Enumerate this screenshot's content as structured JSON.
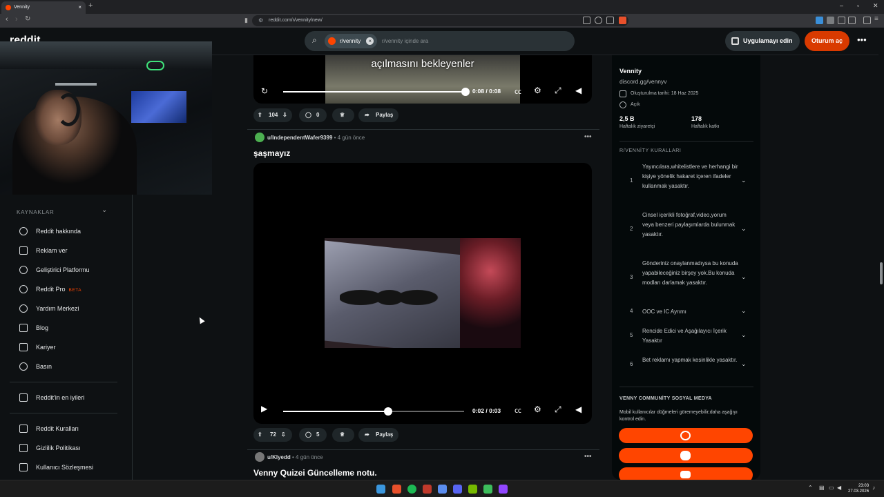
{
  "browser": {
    "tab_title": "Vennity",
    "url": "reddit.com/r/vennity/new/",
    "new_tab": "+",
    "close_tab": "×"
  },
  "header": {
    "logo": "reddit",
    "search_chip": "r/vennity",
    "search_placeholder": "r/vennity içinde ara",
    "get_app_label": "Uygulamayı edin",
    "login_label": "Oturum aç"
  },
  "left_nav": {
    "section_title": "KAYNAKLAR",
    "items": [
      {
        "label": "Reddit hakkında"
      },
      {
        "label": "Reklam ver"
      },
      {
        "label": "Geliştirici Platformu"
      },
      {
        "label": "Reddit Pro",
        "badge": "BETA"
      },
      {
        "label": "Yardım Merkezi"
      },
      {
        "label": "Blog"
      },
      {
        "label": "Kariyer"
      },
      {
        "label": "Basın"
      }
    ],
    "best_of": "Reddit'in en iyileri",
    "legal": [
      {
        "label": "Reddit Kuralları"
      },
      {
        "label": "Gizlilik Politikası"
      },
      {
        "label": "Kullanıcı Sözleşmesi"
      }
    ]
  },
  "feed": {
    "post1": {
      "video_caption": "açılmasını bekleyenler",
      "time": "0:08 / 0:08",
      "progress": 1.0,
      "votes": "104",
      "comments": "0",
      "share": "Paylaş"
    },
    "post2": {
      "author": "u/IndependentWafer9399",
      "age": "• 4 gün önce",
      "title": "şaşmayız",
      "time": "0:02 / 0:03",
      "progress": 0.58,
      "votes": "72",
      "comments": "5",
      "share": "Paylaş"
    },
    "post3": {
      "author": "u/Klyedd",
      "age": "• 4 gün önce",
      "title": "Venny Quizei Güncelleme notu."
    },
    "more": "•••"
  },
  "sidebar": {
    "name": "Vennity",
    "link": "discord.gg/vennyv",
    "created": "Oluşturulma tarihi: 18 Haz 2025",
    "visibility": "Açık",
    "stats": [
      {
        "value": "2,5 B",
        "label": "Haftalık ziyaretçi"
      },
      {
        "value": "178",
        "label": "Haftalık katkı"
      }
    ],
    "rules_title": "R/VENNİTY KURALLARI",
    "rules": [
      {
        "n": "1",
        "text": "Yayıncılara,whitelistlere ve herhangi bir kişiye yönelik hakaret içeren ifadeler kullanmak yasaktır."
      },
      {
        "n": "2",
        "text": "Cinsel içerikli fotoğraf,video,yorum veya benzeri paylaşımlarda bulunmak yasaktır."
      },
      {
        "n": "3",
        "text": "Gönderiniz onaylanmadıysa bu konuda yapabileceğiniz birşey yok.Bu konuda modları darlamak yasaktır."
      },
      {
        "n": "4",
        "text": "OOC ve IC Ayrımı"
      },
      {
        "n": "5",
        "text": "Rencide Edici ve Aşağılayıcı İçerik Yasaktır"
      },
      {
        "n": "6",
        "text": "Bet reklamı yapmak kesinlikle yasaktır."
      }
    ],
    "social_title": "VENNY COMMUNİTY SOSYAL MEDYA",
    "social_desc": "Mobil kullanıcılar düğmeleri göremeyebilir;daha aşağıyı kontrol edin.",
    "social_buttons": [
      {
        "icon": "globe-icon"
      },
      {
        "icon": "discord-icon"
      },
      {
        "icon": "youtube-icon"
      }
    ]
  },
  "taskbar": {
    "time": "23:03",
    "date": "27.03.2026"
  }
}
